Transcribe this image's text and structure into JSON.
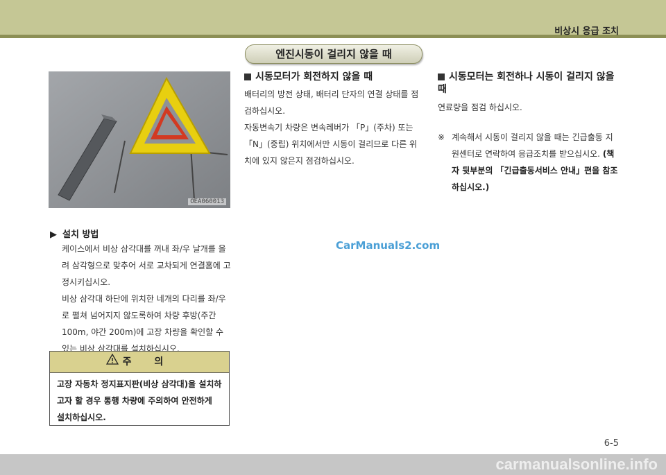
{
  "header": {
    "section_label": "비상시 응급 조치",
    "banner_title": "엔진시동이 걸리지 않을 때"
  },
  "photo": {
    "code": "OEA060013"
  },
  "install": {
    "heading": "설치 방법",
    "para1": "케이스에서 비상 삼각대를 꺼내 좌/우 날개를 올려 삼각형으로 맞추어 서로 교차되게 연결홈에 고정시키십시오.",
    "para2": "비상 삼각대 하단에 위치한 네개의 다리를 좌/우로 펼쳐 넘어지지 않도록하여 차량 후방(주간 100m, 야간 200m)에 고장 차량을 확인할 수 있는 비상 삼각대를 설치하십시오."
  },
  "caution": {
    "title": "주 의",
    "body": "고장 자동차 정지표지판(비상 삼각대)을 설치하고자 할 경우 통행 차량에 주의하여 안전하게 설치하십시오."
  },
  "starter_not_turning": {
    "heading": "시동모터가 회전하지 않을 때",
    "para1": "배터리의 방전 상태, 배터리 단자의 연결 상태를 점검하십시오.",
    "para2": "자동변속기 차량은 변속레버가 「P」(주차) 또는 「N」(중립) 위치에서만 시동이 걸리므로 다른 위치에 있지 않은지 점검하십시오."
  },
  "starter_runs": {
    "heading": "시동모터는 회전하나 시동이 걸리지 않을 때",
    "para1": "연료량을 점검 하십시오.",
    "note_mark": "※",
    "note": "계속해서 시동이 걸리지 않을 때는 긴급출동 지원센터로 연락하여 응급조치를 받으십시오.",
    "note_ref": "(책자 뒷부분의 「긴급출동서비스 안내」편을 참조하십시오.)"
  },
  "watermark": "CarManuals2.com",
  "page_number": "6-5",
  "footer": "carmanualsonline.info",
  "colors": {
    "topbar": "#c5c795",
    "topbar_line": "#8c8f55",
    "caution_head": "#d9d18f",
    "triangle": "#e8cf10",
    "watermark": "#4a9fd6"
  }
}
